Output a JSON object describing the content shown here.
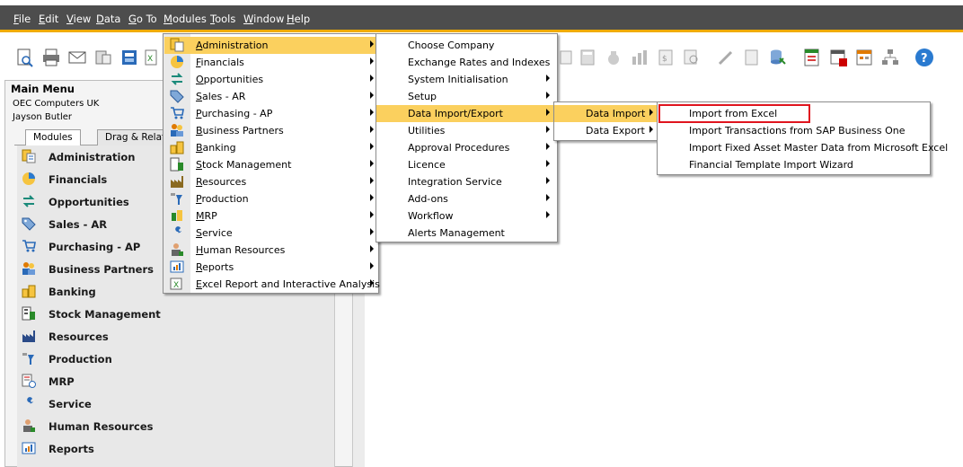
{
  "menubar": {
    "items": [
      "File",
      "Edit",
      "View",
      "Data",
      "Go To",
      "Modules",
      "Tools",
      "Window",
      "Help"
    ],
    "accelerators": [
      "F",
      "E",
      "V",
      "D",
      "G",
      "M",
      "T",
      "W",
      "H"
    ],
    "rests": [
      "ile",
      "dit",
      "iew",
      "ata",
      "o To",
      "odules",
      "ools",
      "indow",
      "elp"
    ]
  },
  "colors": {
    "menubar_bg": "#4d4d4d",
    "accent": "#f0ab00",
    "highlight": "#fbd05e",
    "focus_box": "#e0141e"
  },
  "main_menu": {
    "title": "Main Menu",
    "company": "OEC Computers UK",
    "user": "Jayson Butler",
    "tabs": [
      "Modules",
      "Drag & Relate"
    ],
    "items": [
      {
        "label": "Administration",
        "icon": "administration-icon"
      },
      {
        "label": "Financials",
        "icon": "financials-icon"
      },
      {
        "label": "Opportunities",
        "icon": "opportunities-icon"
      },
      {
        "label": "Sales - AR",
        "icon": "sales-tag-icon"
      },
      {
        "label": "Purchasing - AP",
        "icon": "cart-icon"
      },
      {
        "label": "Business Partners",
        "icon": "people-icon"
      },
      {
        "label": "Banking",
        "icon": "coins-icon"
      },
      {
        "label": "Stock Management",
        "icon": "stock-icon"
      },
      {
        "label": "Resources",
        "icon": "factory-icon"
      },
      {
        "label": "Production",
        "icon": "production-icon"
      },
      {
        "label": "MRP",
        "icon": "mrp-icon"
      },
      {
        "label": "Service",
        "icon": "wrench-icon"
      },
      {
        "label": "Human Resources",
        "icon": "person-icon"
      },
      {
        "label": "Reports",
        "icon": "report-icon"
      }
    ]
  },
  "modules_menu": {
    "items": [
      {
        "acc": "A",
        "rest": "dministration",
        "hl": true
      },
      {
        "acc": "F",
        "rest": "inancials"
      },
      {
        "acc": "O",
        "rest": "pportunities"
      },
      {
        "acc": "S",
        "rest": "ales - AR"
      },
      {
        "acc": "P",
        "rest": "urchasing - AP"
      },
      {
        "acc": "B",
        "rest": "usiness Partners"
      },
      {
        "acc": "B",
        "rest": "anking"
      },
      {
        "acc": "S",
        "rest": "tock Management"
      },
      {
        "acc": "R",
        "rest": "esources"
      },
      {
        "acc": "P",
        "rest": "roduction"
      },
      {
        "acc": "M",
        "rest": "RP"
      },
      {
        "acc": "S",
        "rest": "ervice"
      },
      {
        "acc": "H",
        "rest": "uman Resources"
      },
      {
        "acc": "R",
        "rest": "eports"
      },
      {
        "acc": "E",
        "rest": "xcel Report and Interactive Analysis"
      }
    ]
  },
  "admin_menu": {
    "items": [
      {
        "label": "Choose Company",
        "arrow": false
      },
      {
        "label": "Exchange Rates and Indexes",
        "arrow": false
      },
      {
        "label": "System Initialisation",
        "arrow": true
      },
      {
        "label": "Setup",
        "arrow": true
      },
      {
        "label": "Data Import/Export",
        "arrow": true,
        "hl": true
      },
      {
        "label": "Utilities",
        "arrow": true
      },
      {
        "label": "Approval Procedures",
        "arrow": true
      },
      {
        "label": "Licence",
        "arrow": true
      },
      {
        "label": "Integration Service",
        "arrow": true
      },
      {
        "label": "Add-ons",
        "arrow": true
      },
      {
        "label": "Workflow",
        "arrow": true
      },
      {
        "label": "Alerts Management",
        "arrow": false
      }
    ]
  },
  "data_import_export_menu": {
    "items": [
      {
        "label": "Data Import",
        "hl": true
      },
      {
        "label": "Data Export"
      }
    ]
  },
  "data_import_menu": {
    "items": [
      {
        "label": "Import from Excel"
      },
      {
        "label": "Import Transactions from SAP Business One"
      },
      {
        "label": "Import Fixed Asset Master Data from Microsoft Excel"
      },
      {
        "label": "Financial Template Import Wizard"
      }
    ]
  }
}
